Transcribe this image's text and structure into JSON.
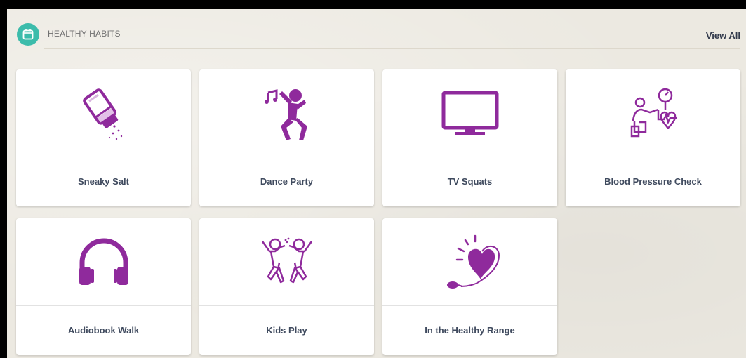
{
  "header": {
    "title": "HEALTHY HABITS",
    "view_all": "View All",
    "icon": "calendar-icon"
  },
  "accent_color": "#8f2a9c",
  "teal_color": "#3cbcab",
  "cards": [
    {
      "label": "Sneaky Salt",
      "icon": "salt-shaker-icon"
    },
    {
      "label": "Dance Party",
      "icon": "dancer-icon"
    },
    {
      "label": "TV Squats",
      "icon": "tv-icon"
    },
    {
      "label": "Blood Pressure Check",
      "icon": "blood-pressure-icon"
    },
    {
      "label": "Audiobook Walk",
      "icon": "headphones-icon"
    },
    {
      "label": "Kids Play",
      "icon": "kids-playing-icon"
    },
    {
      "label": "In the Healthy Range",
      "icon": "heart-gauge-icon"
    }
  ]
}
